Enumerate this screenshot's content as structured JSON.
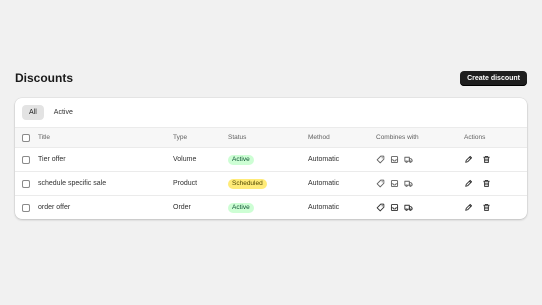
{
  "page": {
    "title": "Discounts",
    "create_label": "Create discount"
  },
  "tabs": [
    {
      "label": "All",
      "selected": true
    },
    {
      "label": "Active",
      "selected": false
    }
  ],
  "columns": {
    "title": "Title",
    "type": "Type",
    "status": "Status",
    "method": "Method",
    "combines": "Combines with",
    "actions": "Actions"
  },
  "rows": [
    {
      "title": "Tier offer",
      "type": "Volume",
      "status": "Active",
      "status_bg": "#cdfed4",
      "status_fg": "#0c5132",
      "method": "Automatic",
      "combines": [
        "tag-icon",
        "box-icon",
        "truck-icon"
      ],
      "combines_strength": "light"
    },
    {
      "title": "schedule specific sale",
      "type": "Product",
      "status": "Scheduled",
      "status_bg": "#ffeb78",
      "status_fg": "#4f4700",
      "method": "Automatic",
      "combines": [
        "tag-icon",
        "box-icon",
        "truck-icon"
      ],
      "combines_strength": "light"
    },
    {
      "title": "order offer",
      "type": "Order",
      "status": "Active",
      "status_bg": "#cdfed4",
      "status_fg": "#0c5132",
      "method": "Automatic",
      "combines": [
        "tag-icon",
        "box-icon",
        "truck-icon"
      ],
      "combines_strength": "dark"
    }
  ],
  "colors": {
    "background": "#f1f1f1",
    "primary_button": "#1f1f1f",
    "header_row": "#f7f7f7"
  }
}
